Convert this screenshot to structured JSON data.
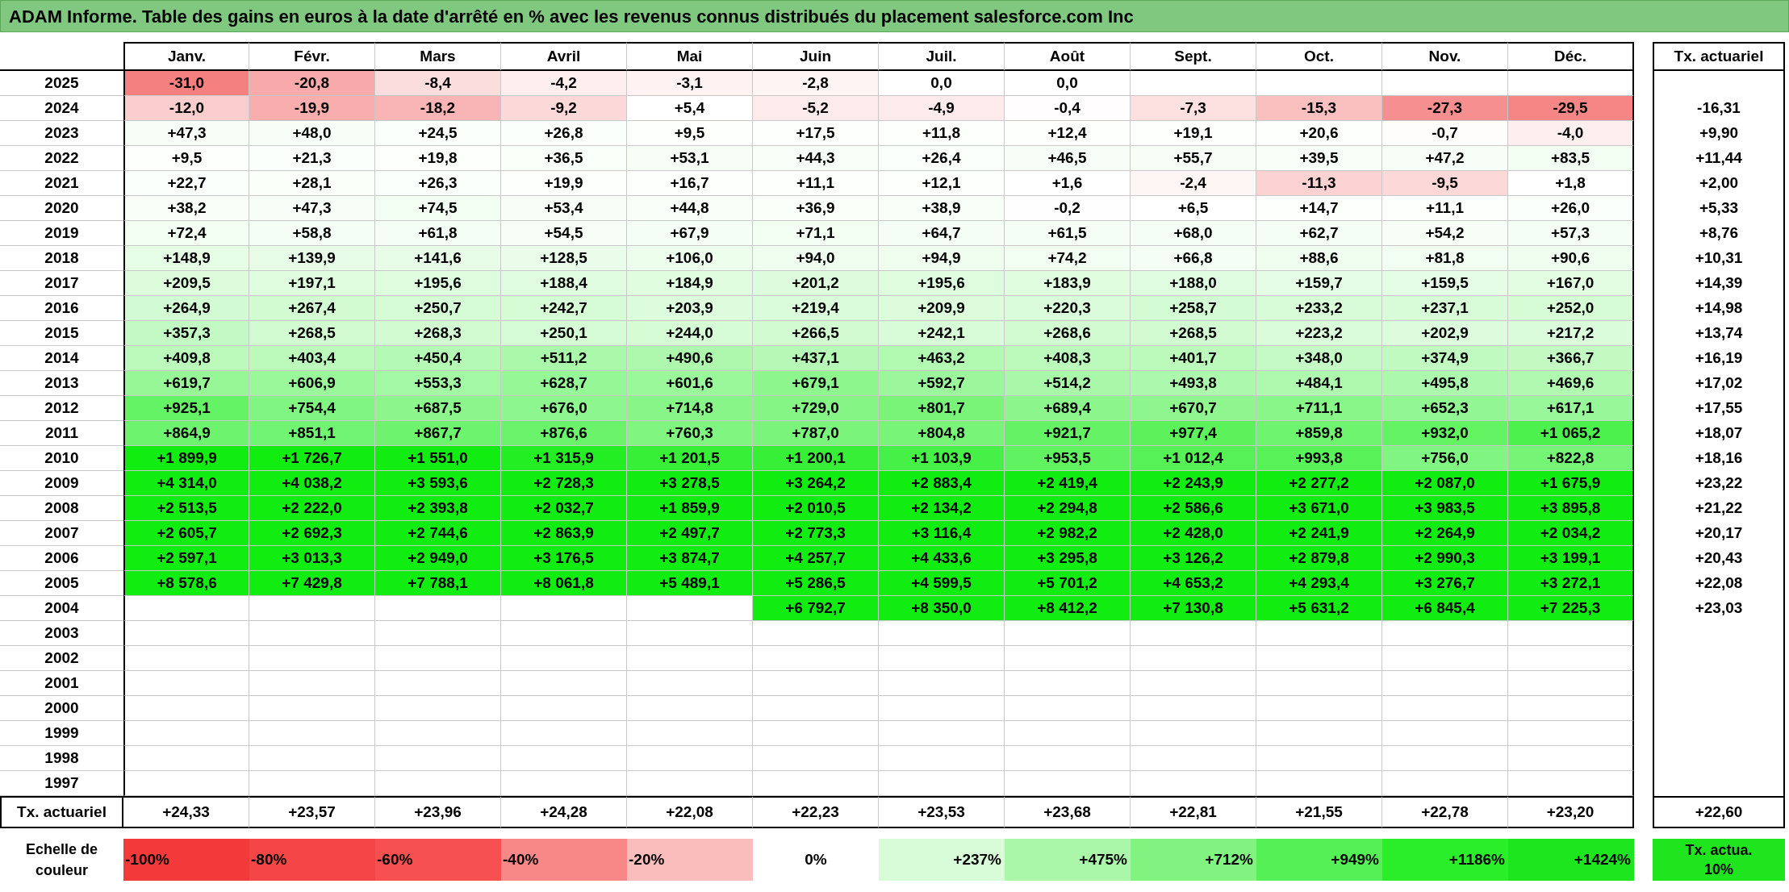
{
  "title": "ADAM Informe. Table des gains en euros à la date d'arrêté en % avec les revenus connus distribués du placement salesforce.com Inc",
  "columns": [
    "Janv.",
    "Févr.",
    "Mars",
    "Avril",
    "Mai",
    "Juin",
    "Juil.",
    "Août",
    "Sept.",
    "Oct.",
    "Nov.",
    "Déc."
  ],
  "rate_header": "Tx. actuariel",
  "rows": [
    {
      "year": "2025",
      "cells": [
        "-31,0",
        "-20,8",
        "-8,4",
        "-4,2",
        "-3,1",
        "-2,8",
        "0,0",
        "0,0",
        null,
        null,
        null,
        null
      ],
      "rate": null
    },
    {
      "year": "2024",
      "cells": [
        "-12,0",
        "-19,9",
        "-18,2",
        "-9,2",
        "+5,4",
        "-5,2",
        "-4,9",
        "-0,4",
        "-7,3",
        "-15,3",
        "-27,3",
        "-29,5"
      ],
      "rate": "-16,31"
    },
    {
      "year": "2023",
      "cells": [
        "+47,3",
        "+48,0",
        "+24,5",
        "+26,8",
        "+9,5",
        "+17,5",
        "+11,8",
        "+12,4",
        "+19,1",
        "+20,6",
        "-0,7",
        "-4,0"
      ],
      "rate": "+9,90"
    },
    {
      "year": "2022",
      "cells": [
        "+9,5",
        "+21,3",
        "+19,8",
        "+36,5",
        "+53,1",
        "+44,3",
        "+26,4",
        "+46,5",
        "+55,7",
        "+39,5",
        "+47,2",
        "+83,5"
      ],
      "rate": "+11,44"
    },
    {
      "year": "2021",
      "cells": [
        "+22,7",
        "+28,1",
        "+26,3",
        "+19,9",
        "+16,7",
        "+11,1",
        "+12,1",
        "+1,6",
        "-2,4",
        "-11,3",
        "-9,5",
        "+1,8"
      ],
      "rate": "+2,00"
    },
    {
      "year": "2020",
      "cells": [
        "+38,2",
        "+47,3",
        "+74,5",
        "+53,4",
        "+44,8",
        "+36,9",
        "+38,9",
        "-0,2",
        "+6,5",
        "+14,7",
        "+11,1",
        "+26,0"
      ],
      "rate": "+5,33"
    },
    {
      "year": "2019",
      "cells": [
        "+72,4",
        "+58,8",
        "+61,8",
        "+54,5",
        "+67,9",
        "+71,1",
        "+64,7",
        "+61,5",
        "+68,0",
        "+62,7",
        "+54,2",
        "+57,3"
      ],
      "rate": "+8,76"
    },
    {
      "year": "2018",
      "cells": [
        "+148,9",
        "+139,9",
        "+141,6",
        "+128,5",
        "+106,0",
        "+94,0",
        "+94,9",
        "+74,2",
        "+66,8",
        "+88,6",
        "+81,8",
        "+90,6"
      ],
      "rate": "+10,31"
    },
    {
      "year": "2017",
      "cells": [
        "+209,5",
        "+197,1",
        "+195,6",
        "+188,4",
        "+184,9",
        "+201,2",
        "+195,6",
        "+183,9",
        "+188,0",
        "+159,7",
        "+159,5",
        "+167,0"
      ],
      "rate": "+14,39"
    },
    {
      "year": "2016",
      "cells": [
        "+264,9",
        "+267,4",
        "+250,7",
        "+242,7",
        "+203,9",
        "+219,4",
        "+209,9",
        "+220,3",
        "+258,7",
        "+233,2",
        "+237,1",
        "+252,0"
      ],
      "rate": "+14,98"
    },
    {
      "year": "2015",
      "cells": [
        "+357,3",
        "+268,5",
        "+268,3",
        "+250,1",
        "+244,0",
        "+266,5",
        "+242,1",
        "+268,6",
        "+268,5",
        "+223,2",
        "+202,9",
        "+217,2"
      ],
      "rate": "+13,74"
    },
    {
      "year": "2014",
      "cells": [
        "+409,8",
        "+403,4",
        "+450,4",
        "+511,2",
        "+490,6",
        "+437,1",
        "+463,2",
        "+408,3",
        "+401,7",
        "+348,0",
        "+374,9",
        "+366,7"
      ],
      "rate": "+16,19"
    },
    {
      "year": "2013",
      "cells": [
        "+619,7",
        "+606,9",
        "+553,3",
        "+628,7",
        "+601,6",
        "+679,1",
        "+592,7",
        "+514,2",
        "+493,8",
        "+484,1",
        "+495,8",
        "+469,6"
      ],
      "rate": "+17,02"
    },
    {
      "year": "2012",
      "cells": [
        "+925,1",
        "+754,4",
        "+687,5",
        "+676,0",
        "+714,8",
        "+729,0",
        "+801,7",
        "+689,4",
        "+670,7",
        "+711,1",
        "+652,3",
        "+617,1"
      ],
      "rate": "+17,55"
    },
    {
      "year": "2011",
      "cells": [
        "+864,9",
        "+851,1",
        "+867,7",
        "+876,6",
        "+760,3",
        "+787,0",
        "+804,8",
        "+921,7",
        "+977,4",
        "+859,8",
        "+932,0",
        "+1 065,2"
      ],
      "rate": "+18,07"
    },
    {
      "year": "2010",
      "cells": [
        "+1 899,9",
        "+1 726,7",
        "+1 551,0",
        "+1 315,9",
        "+1 201,5",
        "+1 200,1",
        "+1 103,9",
        "+953,5",
        "+1 012,4",
        "+993,8",
        "+756,0",
        "+822,8"
      ],
      "rate": "+18,16"
    },
    {
      "year": "2009",
      "cells": [
        "+4 314,0",
        "+4 038,2",
        "+3 593,6",
        "+2 728,3",
        "+3 278,5",
        "+3 264,2",
        "+2 883,4",
        "+2 419,4",
        "+2 243,9",
        "+2 277,2",
        "+2 087,0",
        "+1 675,9"
      ],
      "rate": "+23,22"
    },
    {
      "year": "2008",
      "cells": [
        "+2 513,5",
        "+2 222,0",
        "+2 393,8",
        "+2 032,7",
        "+1 859,9",
        "+2 010,5",
        "+2 134,2",
        "+2 294,8",
        "+2 586,6",
        "+3 671,0",
        "+3 983,5",
        "+3 895,8"
      ],
      "rate": "+21,22"
    },
    {
      "year": "2007",
      "cells": [
        "+2 605,7",
        "+2 692,3",
        "+2 744,6",
        "+2 863,9",
        "+2 497,7",
        "+2 773,3",
        "+3 116,4",
        "+2 982,2",
        "+2 428,0",
        "+2 241,9",
        "+2 264,9",
        "+2 034,2"
      ],
      "rate": "+20,17"
    },
    {
      "year": "2006",
      "cells": [
        "+2 597,1",
        "+3 013,3",
        "+2 949,0",
        "+3 176,5",
        "+3 874,7",
        "+4 257,7",
        "+4 433,6",
        "+3 295,8",
        "+3 126,2",
        "+2 879,8",
        "+2 990,3",
        "+3 199,1"
      ],
      "rate": "+20,43"
    },
    {
      "year": "2005",
      "cells": [
        "+8 578,6",
        "+7 429,8",
        "+7 788,1",
        "+8 061,8",
        "+5 489,1",
        "+5 286,5",
        "+4 599,5",
        "+5 701,2",
        "+4 653,2",
        "+4 293,4",
        "+3 276,7",
        "+3 272,1"
      ],
      "rate": "+22,08"
    },
    {
      "year": "2004",
      "cells": [
        null,
        null,
        null,
        null,
        null,
        "+6 792,7",
        "+8 350,0",
        "+8 412,2",
        "+7 130,8",
        "+5 631,2",
        "+6 845,4",
        "+7 225,3"
      ],
      "rate": "+23,03"
    },
    {
      "year": "2003",
      "cells": [
        null,
        null,
        null,
        null,
        null,
        null,
        null,
        null,
        null,
        null,
        null,
        null
      ],
      "rate": null
    },
    {
      "year": "2002",
      "cells": [
        null,
        null,
        null,
        null,
        null,
        null,
        null,
        null,
        null,
        null,
        null,
        null
      ],
      "rate": null
    },
    {
      "year": "2001",
      "cells": [
        null,
        null,
        null,
        null,
        null,
        null,
        null,
        null,
        null,
        null,
        null,
        null
      ],
      "rate": null
    },
    {
      "year": "2000",
      "cells": [
        null,
        null,
        null,
        null,
        null,
        null,
        null,
        null,
        null,
        null,
        null,
        null
      ],
      "rate": null
    },
    {
      "year": "1999",
      "cells": [
        null,
        null,
        null,
        null,
        null,
        null,
        null,
        null,
        null,
        null,
        null,
        null
      ],
      "rate": null
    },
    {
      "year": "1998",
      "cells": [
        null,
        null,
        null,
        null,
        null,
        null,
        null,
        null,
        null,
        null,
        null,
        null
      ],
      "rate": null
    },
    {
      "year": "1997",
      "cells": [
        null,
        null,
        null,
        null,
        null,
        null,
        null,
        null,
        null,
        null,
        null,
        null
      ],
      "rate": null
    }
  ],
  "footer": {
    "label": "Tx. actuariel",
    "cells": [
      "+24,33",
      "+23,57",
      "+23,96",
      "+24,28",
      "+22,08",
      "+22,23",
      "+23,53",
      "+23,68",
      "+22,81",
      "+21,55",
      "+22,78",
      "+23,20"
    ],
    "rate": "+22,60"
  },
  "legend": {
    "label": "Echelle de couleur",
    "items": [
      {
        "label": "-100%",
        "color": "#f23a3a",
        "kind": "negative"
      },
      {
        "label": "-80%",
        "color": "#f44646",
        "kind": "negative"
      },
      {
        "label": "-60%",
        "color": "#f65050",
        "kind": "negative"
      },
      {
        "label": "-40%",
        "color": "#f88888",
        "kind": "negative"
      },
      {
        "label": "-20%",
        "color": "#fbbcbc",
        "kind": "negative"
      },
      {
        "label": "0%",
        "color": "#ffffff",
        "kind": "zero"
      },
      {
        "label": "+237%",
        "color": "#d8fcd8",
        "kind": "positive"
      },
      {
        "label": "+475%",
        "color": "#aaf7aa",
        "kind": "positive"
      },
      {
        "label": "+712%",
        "color": "#80f380",
        "kind": "positive"
      },
      {
        "label": "+949%",
        "color": "#55f055",
        "kind": "positive"
      },
      {
        "label": "+1186%",
        "color": "#2aee2a",
        "kind": "positive"
      },
      {
        "label": "+1424%",
        "color": "#1ee61e",
        "kind": "positive"
      }
    ],
    "rate_item": {
      "label": "Tx. actua. 10%",
      "color": "#1ee51e"
    }
  }
}
